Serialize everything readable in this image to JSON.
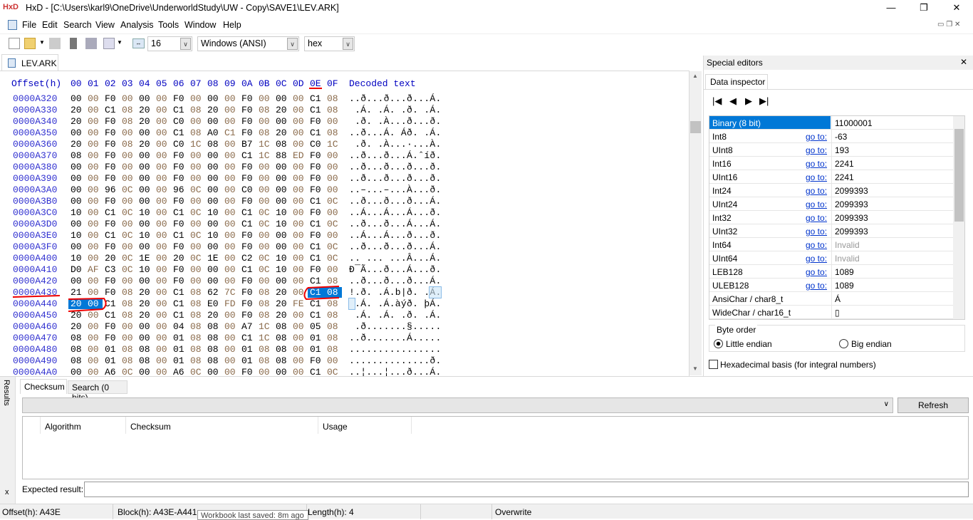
{
  "window": {
    "title": "HxD - [C:\\Users\\karl9\\OneDrive\\UnderworldStudy\\UW - Copy\\SAVE1\\LEV.ARK]",
    "minimize": "—",
    "restore": "❐",
    "close": "✕"
  },
  "menu": [
    "File",
    "Edit",
    "Search",
    "View",
    "Analysis",
    "Tools",
    "Window",
    "Help"
  ],
  "toolbar": {
    "bytes_per_row": "16",
    "charset": "Windows (ANSI)",
    "offset_base": "hex"
  },
  "doc_tab": "LEV.ARK",
  "hex": {
    "header_offset": "Offset(h)",
    "header_cols": [
      "00",
      "01",
      "02",
      "03",
      "04",
      "05",
      "06",
      "07",
      "08",
      "09",
      "0A",
      "0B",
      "0C",
      "0D",
      "0E",
      "0F"
    ],
    "header_decoded": "Decoded text",
    "rows": [
      {
        "offset": "0000A320",
        "bytes": "00 00 F0 00 00 00 F0 00 00 00 F0 00 00 00 C1 08",
        "text": "..ð...ð...ð...Á."
      },
      {
        "offset": "0000A330",
        "bytes": "20 00 C1 08 20 00 C1 08 20 00 F0 08 20 00 C1 08",
        "text": " .Á. .Á. .ð. .Á."
      },
      {
        "offset": "0000A340",
        "bytes": "20 00 F0 08 20 00 C0 00 00 00 F0 00 00 00 F0 00",
        "text": " .ð. .À...ð...ð."
      },
      {
        "offset": "0000A350",
        "bytes": "00 00 F0 00 00 00 C1 08 A0 C1 F0 08 20 00 C1 08",
        "text": "..ð...Á. Áð. .Á."
      },
      {
        "offset": "0000A360",
        "bytes": "20 00 F0 08 20 00 C0 1C 08 00 B7 1C 08 00 C0 1C",
        "text": " .ð. .À...·...À."
      },
      {
        "offset": "0000A370",
        "bytes": "08 00 F0 00 00 00 F0 00 00 00 C1 1C 88 ED F0 00",
        "text": "..ð...ð...Á.ˆíð."
      },
      {
        "offset": "0000A380",
        "bytes": "00 00 F0 00 00 00 F0 00 00 00 F0 00 00 00 F0 00",
        "text": "..ð...ð...ð...ð."
      },
      {
        "offset": "0000A390",
        "bytes": "00 00 F0 00 00 00 F0 00 00 00 F0 00 00 00 F0 00",
        "text": "..ð...ð...ð...ð."
      },
      {
        "offset": "0000A3A0",
        "bytes": "00 00 96 0C 00 00 96 0C 00 00 C0 00 00 00 F0 00",
        "text": "..–...–...À...ð."
      },
      {
        "offset": "0000A3B0",
        "bytes": "00 00 F0 00 00 00 F0 00 00 00 F0 00 00 00 C1 0C",
        "text": "..ð...ð...ð...Á."
      },
      {
        "offset": "0000A3C0",
        "bytes": "10 00 C1 0C 10 00 C1 0C 10 00 C1 0C 10 00 F0 00",
        "text": "..Á...Á...Á...ð."
      },
      {
        "offset": "0000A3D0",
        "bytes": "00 00 F0 00 00 00 F0 00 00 00 C1 0C 10 00 C1 0C",
        "text": "..ð...ð...Á...Á."
      },
      {
        "offset": "0000A3E0",
        "bytes": "10 00 C1 0C 10 00 C1 0C 10 00 F0 00 00 00 F0 00",
        "text": "..Á...Á...ð...ð."
      },
      {
        "offset": "0000A3F0",
        "bytes": "00 00 F0 00 00 00 F0 00 00 00 F0 00 00 00 C1 0C",
        "text": "..ð...ð...ð...Á."
      },
      {
        "offset": "0000A400",
        "bytes": "10 00 20 0C 1E 00 20 0C 1E 00 C2 0C 10 00 C1 0C",
        "text": ".. ... ...Â...Á."
      },
      {
        "offset": "0000A410",
        "bytes": "D0 AF C3 0C 10 00 F0 00 00 00 C1 0C 10 00 F0 00",
        "text": "Ð¯Ã...ð...Á...ð."
      },
      {
        "offset": "0000A420",
        "bytes": "00 00 F0 00 00 00 F0 00 00 00 F0 00 00 00 C1 08",
        "text": "..ð...ð...ð...Á."
      },
      {
        "offset": "0000A430",
        "bytes": "21 00 F0 08 20 00 C1 08 62 7C F0 08 20 00 C1 08",
        "text": "!.ð. .Á.b|ð. .Á."
      },
      {
        "offset": "0000A440",
        "bytes": "20 00 C1 08 20 00 C1 08 E0 FD F0 08 20 FE C1 08",
        "text": " .Á. .Á.àýð. þÁ."
      },
      {
        "offset": "0000A450",
        "bytes": "20 00 C1 08 20 00 C1 08 20 00 F0 08 20 00 C1 08",
        "text": " .Á. .Á. .ð. .Á."
      },
      {
        "offset": "0000A460",
        "bytes": "20 00 F0 00 00 00 04 08 08 00 A7 1C 08 00 05 08",
        "text": " .ð.......§....."
      },
      {
        "offset": "0000A470",
        "bytes": "08 00 F0 00 00 00 01 08 08 00 C1 1C 08 00 01 08",
        "text": "..ð.......Á....."
      },
      {
        "offset": "0000A480",
        "bytes": "08 00 01 08 08 00 01 08 08 00 01 08 08 00 01 08",
        "text": "................"
      },
      {
        "offset": "0000A490",
        "bytes": "08 00 01 08 08 00 01 08 08 00 01 08 08 00 F0 00",
        "text": "..............ð."
      },
      {
        "offset": "0000A4A0",
        "bytes": "00 00 A6 0C 00 00 A6 0C 00 00 F0 00 00 00 C1 0C",
        "text": "..¦...¦...ð...Á."
      }
    ]
  },
  "special_editors": {
    "title": "Special editors",
    "close": "✕",
    "tab": "Data inspector",
    "rows": [
      {
        "name": "Binary (8 bit)",
        "goto": "",
        "value": "11000001"
      },
      {
        "name": "Int8",
        "goto": "go to:",
        "value": "-63"
      },
      {
        "name": "UInt8",
        "goto": "go to:",
        "value": "193"
      },
      {
        "name": "Int16",
        "goto": "go to:",
        "value": "2241"
      },
      {
        "name": "UInt16",
        "goto": "go to:",
        "value": "2241"
      },
      {
        "name": "Int24",
        "goto": "go to:",
        "value": "2099393"
      },
      {
        "name": "UInt24",
        "goto": "go to:",
        "value": "2099393"
      },
      {
        "name": "Int32",
        "goto": "go to:",
        "value": "2099393"
      },
      {
        "name": "UInt32",
        "goto": "go to:",
        "value": "2099393"
      },
      {
        "name": "Int64",
        "goto": "go to:",
        "value": "Invalid"
      },
      {
        "name": "UInt64",
        "goto": "go to:",
        "value": "Invalid"
      },
      {
        "name": "LEB128",
        "goto": "go to:",
        "value": "1089"
      },
      {
        "name": "ULEB128",
        "goto": "go to:",
        "value": "1089"
      },
      {
        "name": "AnsiChar / char8_t",
        "goto": "",
        "value": "Á"
      },
      {
        "name": "WideChar / char16_t",
        "goto": "",
        "value": "▯"
      }
    ],
    "byte_order": {
      "label": "Byte order",
      "little": "Little endian",
      "big": "Big endian",
      "selected": "little"
    },
    "hex_basis": {
      "label": "Hexadecimal basis (for integral numbers)",
      "checked": false
    }
  },
  "results": {
    "side_tab": "Results",
    "close": "x",
    "tabs": [
      "Checksum",
      "Search (0 hits)"
    ],
    "refresh": "Refresh",
    "columns": [
      "Algorithm",
      "Checksum",
      "Usage"
    ],
    "expected_label": "Expected result:"
  },
  "status": {
    "offset": "Offset(h): A43E",
    "block": "Block(h): A43E-A441",
    "length": "Length(h): 4",
    "mode": "Overwrite",
    "tooltip": "Workbook last saved: 8m ago"
  },
  "colors": {
    "selection": "#0078d7",
    "offset": "#3030d0",
    "annotation": "#e00000"
  }
}
